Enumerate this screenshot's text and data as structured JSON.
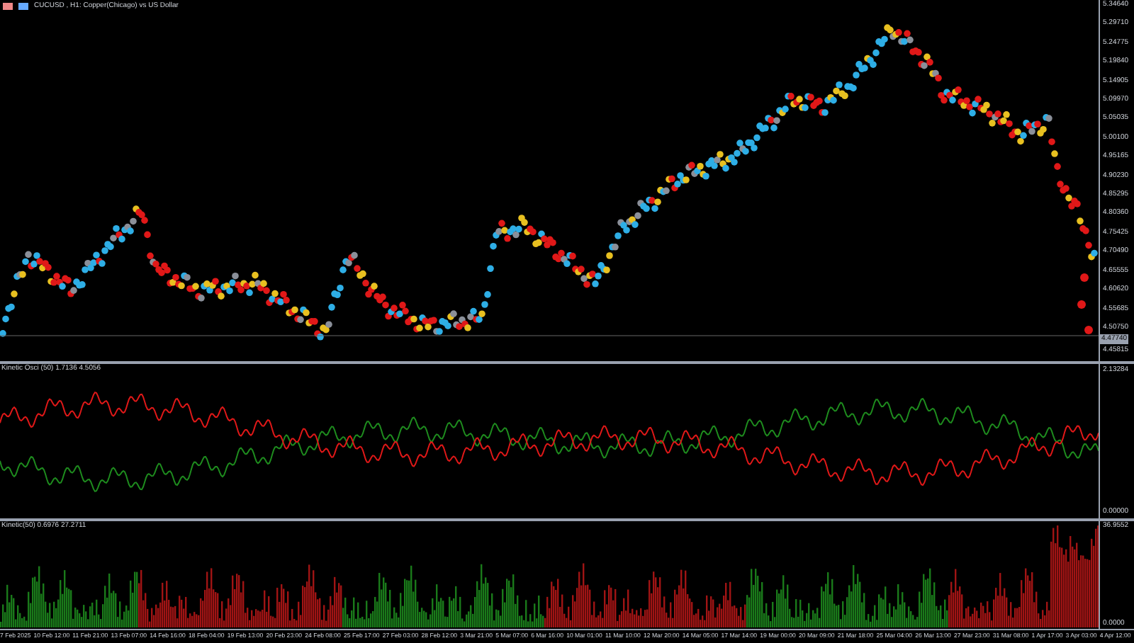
{
  "window": {
    "title": "CUCUSD , H1:  Copper(Chicago) vs  US Dollar"
  },
  "price_axis": {
    "labels": [
      "5.34640",
      "5.29710",
      "5.24775",
      "5.19840",
      "5.14905",
      "5.09970",
      "5.05035",
      "5.00100",
      "4.95165",
      "4.90230",
      "4.85295",
      "4.80360",
      "4.75425",
      "4.70490",
      "4.65555",
      "4.60620",
      "4.55685",
      "4.50750",
      "4.45815"
    ],
    "current_price": "4.47740"
  },
  "oscillator": {
    "label": "Kinetic Osci (50) 1.7136 4.5056",
    "axis": [
      "2.13284",
      "0.00000"
    ]
  },
  "histogram": {
    "label": "Kinetic(50) 0.6976 27.2711",
    "axis": [
      "36.9552",
      "0.0000"
    ]
  },
  "time_axis": {
    "labels": [
      "7 Feb 2025",
      "10 Feb 12:00",
      "11 Feb 21:00",
      "13 Feb 07:00",
      "14 Feb 16:00",
      "18 Feb 04:00",
      "19 Feb 13:00",
      "20 Feb 23:00",
      "24 Feb 08:00",
      "25 Feb 17:00",
      "27 Feb 03:00",
      "28 Feb 12:00",
      "3 Mar 21:00",
      "5 Mar 07:00",
      "6 Mar 16:00",
      "10 Mar 01:00",
      "11 Mar 10:00",
      "12 Mar 20:00",
      "14 Mar 05:00",
      "17 Mar 14:00",
      "19 Mar 00:00",
      "20 Mar 09:00",
      "21 Mar 18:00",
      "25 Mar 04:00",
      "26 Mar 13:00",
      "27 Mar 23:00",
      "31 Mar 08:00",
      "1 Apr 17:00",
      "3 Apr 03:00",
      "4 Apr 12:00"
    ]
  }
}
